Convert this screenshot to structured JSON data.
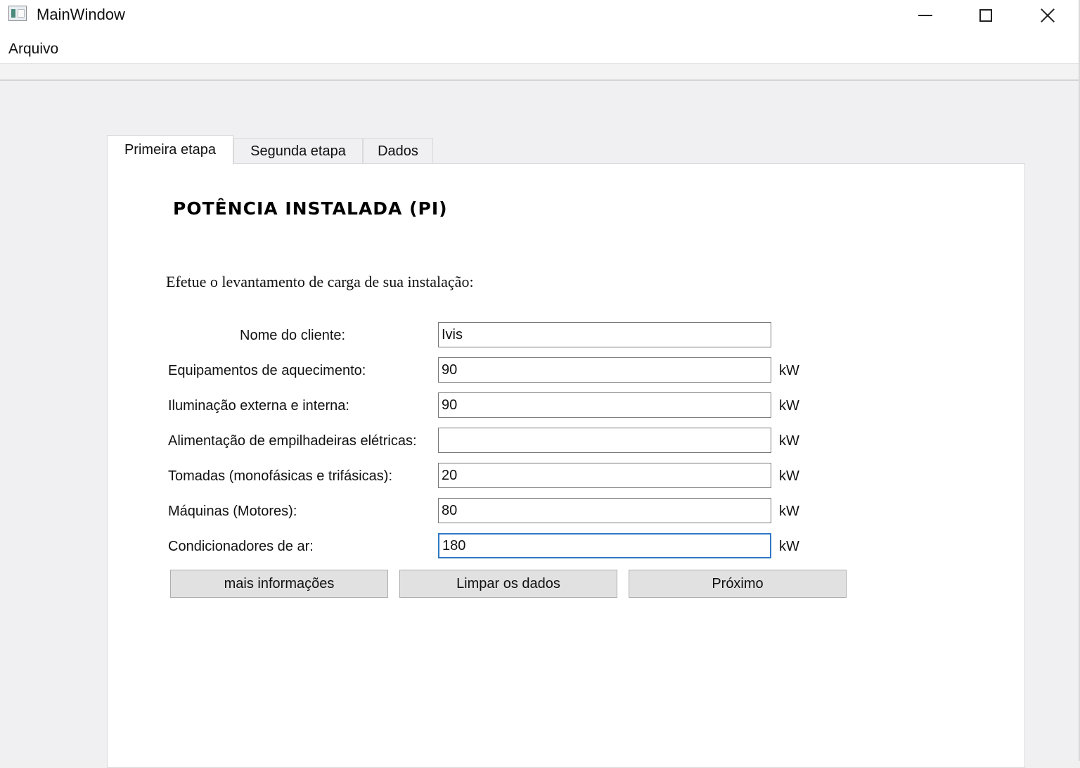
{
  "window": {
    "title": "MainWindow"
  },
  "menu": {
    "items": [
      "Arquivo"
    ]
  },
  "tabs": [
    {
      "label": "Primeira etapa",
      "active": true
    },
    {
      "label": "Segunda etapa",
      "active": false
    },
    {
      "label": "Dados",
      "active": false
    }
  ],
  "panel": {
    "heading": "POTÊNCIA INSTALADA (PI)",
    "instruction": "Efetue o levantamento de carga de sua instalação:",
    "fields": [
      {
        "label": "Nome do cliente:",
        "value": "Ivis",
        "unit": ""
      },
      {
        "label": "Equipamentos de aquecimento:",
        "value": "90",
        "unit": "kW"
      },
      {
        "label": "Iluminação externa e interna:",
        "value": "90",
        "unit": "kW"
      },
      {
        "label": "Alimentação de empilhadeiras elétricas:",
        "value": "",
        "unit": "kW"
      },
      {
        "label": "Tomadas (monofásicas e trifásicas):",
        "value": "20",
        "unit": "kW"
      },
      {
        "label": "Máquinas (Motores):",
        "value": "80",
        "unit": "kW"
      },
      {
        "label": "Condicionadores de ar:",
        "value": "180",
        "unit": "kW"
      }
    ],
    "buttons": {
      "more_info": "mais informações",
      "clear": "Limpar os dados",
      "next": "Próximo"
    }
  },
  "colors": {
    "window_bg": "#f0eff2",
    "panel_bg": "#ffffff",
    "focus_border": "#2f78c4",
    "button_bg": "#e1e1e1"
  }
}
